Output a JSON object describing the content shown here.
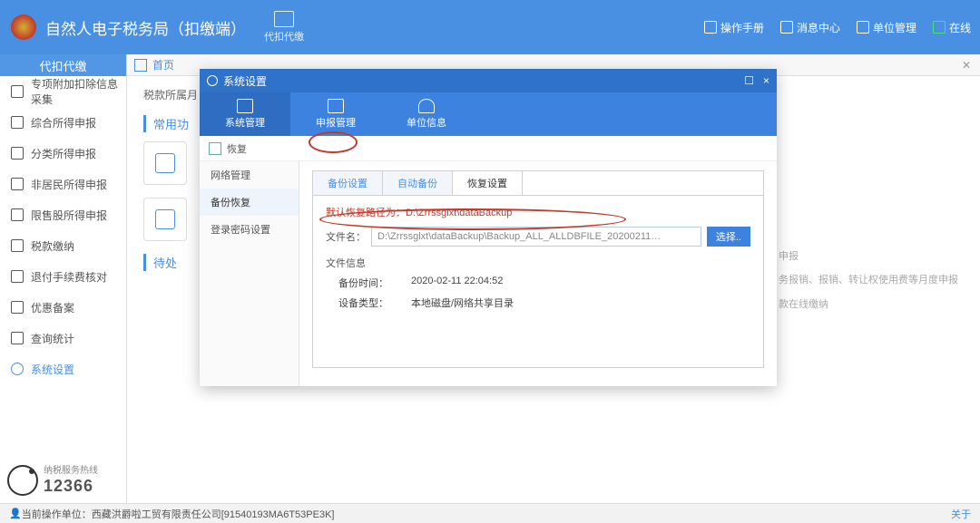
{
  "window_controls": {
    "min": "—",
    "max": "☐",
    "close": "×"
  },
  "header": {
    "title": "自然人电子税务局（扣缴端）",
    "tab": "代扣代缴",
    "right": [
      {
        "id": "manual",
        "label": "操作手册"
      },
      {
        "id": "msg",
        "label": "消息中心"
      },
      {
        "id": "unit",
        "label": "单位管理"
      },
      {
        "id": "online",
        "label": "在线"
      }
    ]
  },
  "sidebar": {
    "header": "代扣代缴",
    "items": [
      {
        "id": "sp",
        "label": "专项附加扣除信息采集"
      },
      {
        "id": "zh",
        "label": "综合所得申报"
      },
      {
        "id": "fl",
        "label": "分类所得申报"
      },
      {
        "id": "fj",
        "label": "非居民所得申报"
      },
      {
        "id": "xg",
        "label": "限售股所得申报"
      },
      {
        "id": "sk",
        "label": "税款缴纳"
      },
      {
        "id": "tf",
        "label": "退付手续费核对"
      },
      {
        "id": "yh",
        "label": "优惠备案"
      },
      {
        "id": "cx",
        "label": "查询统计"
      },
      {
        "id": "xt",
        "label": "系统设置",
        "active": true
      }
    ]
  },
  "main": {
    "home_tab": "首页",
    "crumb": "税款所属月",
    "section1": "常用功",
    "section2": "待处",
    "right_hints": [
      "申报",
      "务报销、报销、转让权使用费等月度申报",
      "款在线缴纳"
    ]
  },
  "modal": {
    "title": "系统设置",
    "toolbar": [
      {
        "id": "sys",
        "label": "系统管理",
        "active": true
      },
      {
        "id": "decl",
        "label": "申报管理"
      },
      {
        "id": "unit",
        "label": "单位信息"
      }
    ],
    "sub_action": "恢复",
    "side": [
      {
        "id": "net",
        "label": "网络管理"
      },
      {
        "id": "bk",
        "label": "备份恢复",
        "active": true
      },
      {
        "id": "pw",
        "label": "登录密码设置"
      }
    ],
    "innertabs": [
      {
        "id": "bkset",
        "label": "备份设置"
      },
      {
        "id": "auto",
        "label": "自动备份"
      },
      {
        "id": "restore",
        "label": "恢复设置",
        "active": true
      }
    ],
    "default_path": "默认恢复路径为：D:\\Zrrssglxt\\dataBackup",
    "file_label": "文件名：",
    "file_value": "D:\\Zrrssglxt\\dataBackup\\Backup_ALL_ALLDBFILE_20200211…",
    "browse": "选择..",
    "info_header": "文件信息",
    "rows": [
      {
        "k": "备份时间：",
        "v": "2020-02-11 22:04:52"
      },
      {
        "k": "设备类型：",
        "v": "本地磁盘/网络共享目录"
      }
    ]
  },
  "hotline": {
    "caption": "纳税服务热线",
    "number": "12366"
  },
  "footer": {
    "prefix": "当前操作单位：",
    "unit": "西藏洪爵啦工贸有限责任公司[91540193MA6T53PE3K]",
    "about": "关于"
  }
}
